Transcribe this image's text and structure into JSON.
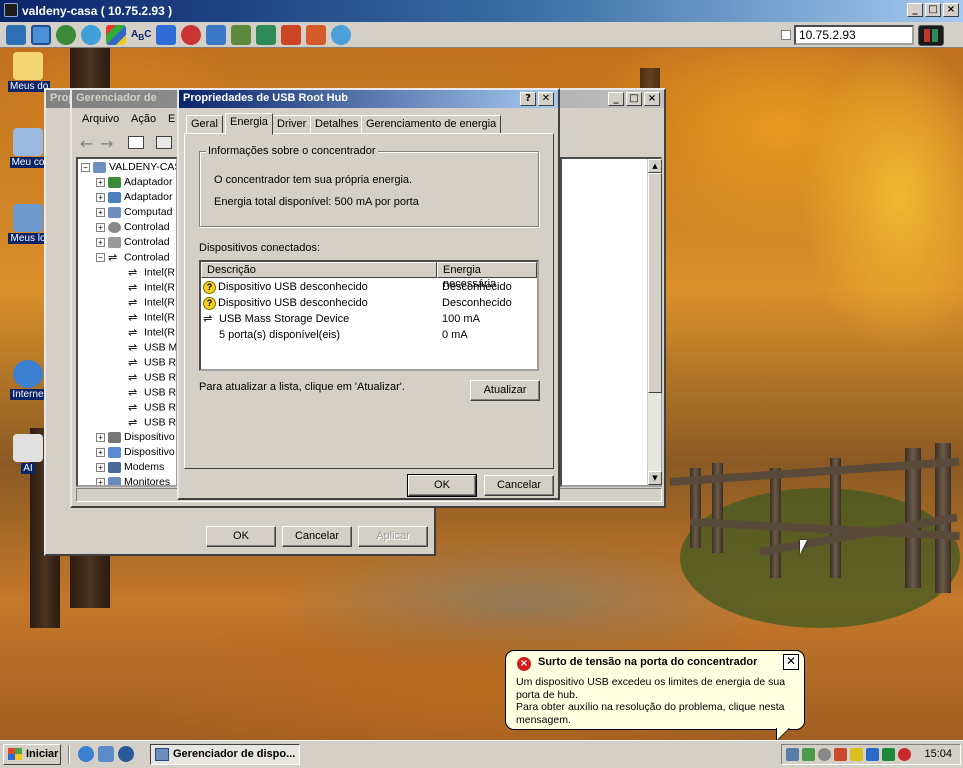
{
  "viewer": {
    "title": "valdeny-casa ( 10.75.2.93 )",
    "address": "10.75.2.93"
  },
  "desktop_icons": [
    {
      "label": "Meus do"
    },
    {
      "label": "Meu co"
    },
    {
      "label": "Meus lo"
    },
    {
      "label": "Interne"
    },
    {
      "label": "AI"
    }
  ],
  "bg_properties": {
    "title_fragment": "Prop",
    "ok": "OK",
    "cancel": "Cancelar",
    "apply": "Aplicar"
  },
  "device_manager": {
    "title": "Gerenciador de",
    "menu": [
      "Arquivo",
      "Ação",
      "E"
    ],
    "tree": [
      {
        "label": "VALDENY-CASA",
        "level": 0,
        "expander": "-"
      },
      {
        "label": "Adaptador",
        "level": 1,
        "expander": "+"
      },
      {
        "label": "Adaptador",
        "level": 1,
        "expander": "+"
      },
      {
        "label": "Computad",
        "level": 1,
        "expander": "+"
      },
      {
        "label": "Controlad",
        "level": 1,
        "expander": "+"
      },
      {
        "label": "Controlad",
        "level": 1,
        "expander": "+"
      },
      {
        "label": "Controlad",
        "level": 1,
        "expander": "-"
      },
      {
        "label": "Intel(R",
        "level": 2
      },
      {
        "label": "Intel(R",
        "level": 2
      },
      {
        "label": "Intel(R",
        "level": 2
      },
      {
        "label": "Intel(R",
        "level": 2
      },
      {
        "label": "Intel(R",
        "level": 2
      },
      {
        "label": "USB M",
        "level": 2
      },
      {
        "label": "USB Ro",
        "level": 2
      },
      {
        "label": "USB Ro",
        "level": 2
      },
      {
        "label": "USB Ro",
        "level": 2
      },
      {
        "label": "USB Ro",
        "level": 2
      },
      {
        "label": "USB Ro",
        "level": 2
      },
      {
        "label": "Dispositivo",
        "level": 1,
        "expander": "+"
      },
      {
        "label": "Dispositivo",
        "level": 1,
        "expander": "+"
      },
      {
        "label": "Modems",
        "level": 1,
        "expander": "+"
      },
      {
        "label": "Monitores",
        "level": 1,
        "expander": "+"
      }
    ]
  },
  "dialog": {
    "title": "Propriedades de USB Root Hub",
    "help": "?",
    "close": "✕",
    "tabs": [
      "Geral",
      "Energia",
      "Driver",
      "Detalhes",
      "Gerenciamento de energia"
    ],
    "group_title": "Informações sobre o concentrador",
    "self_power": "O concentrador tem sua própria energia.",
    "total_power": "Energia total disponível:  500 mA por porta",
    "connected_label": "Dispositivos conectados:",
    "col_desc": "Descrição",
    "col_power": "Energia necessária",
    "devices": [
      {
        "name": "Dispositivo USB desconhecido",
        "power": "Desconhecido",
        "icon": "warning"
      },
      {
        "name": "Dispositivo USB desconhecido",
        "power": "Desconhecido",
        "icon": "warning"
      },
      {
        "name": "USB Mass Storage Device",
        "power": "100 mA",
        "icon": "usb"
      },
      {
        "name": "5 porta(s) disponível(eis)",
        "power": "0 mA",
        "icon": "none"
      }
    ],
    "refresh_hint": "Para atualizar a lista, clique em 'Atualizar'.",
    "refresh": "Atualizar",
    "ok": "OK",
    "cancel": "Cancelar"
  },
  "balloon": {
    "title": "Surto de tensão na porta do concentrador",
    "body_1": "Um dispositivo USB excedeu os limites de energia de sua porta de hub.",
    "body_2": "Para obter auxílio na resolução do problema, clique nesta mensagem.",
    "close": "✕"
  },
  "taskbar": {
    "start": "Iniciar",
    "task": "Gerenciador de dispo...",
    "clock": "15:04"
  }
}
